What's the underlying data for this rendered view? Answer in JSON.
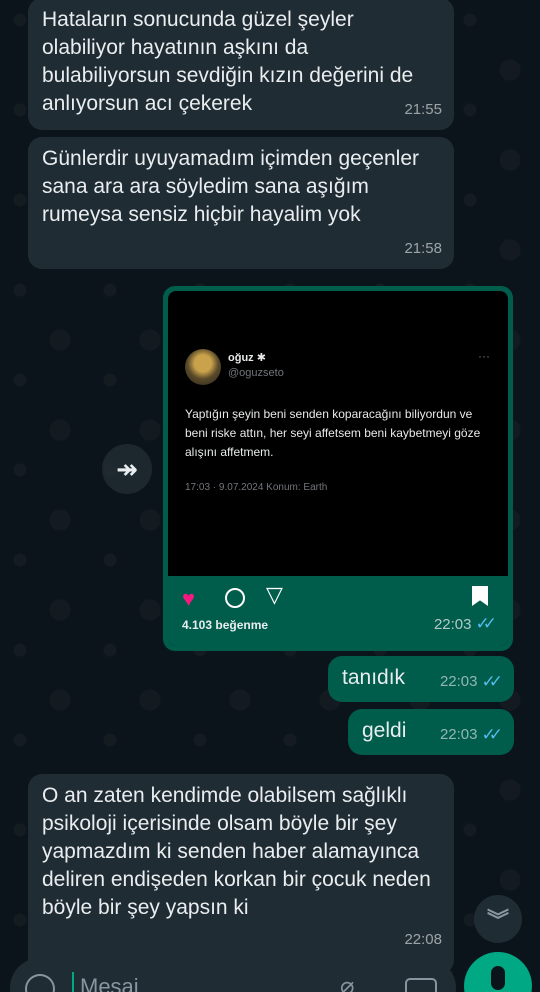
{
  "messages": [
    {
      "text": "Hataların sonucunda güzel şeyler olabiliyor hayatının aşkını da bulabiliyorsun sevdiğin kızın değerini de anlıyorsun acı çekerek",
      "time": "21:55"
    },
    {
      "text": "Günlerdir uyuyamadım içimden geçenler sana ara ara söyledim sana aşığım rumeysa sensiz hiçbir hayalim yok",
      "time": "21:58"
    },
    {
      "text": "tanıdık",
      "time": "22:03"
    },
    {
      "text": "geldi",
      "time": "22:03"
    },
    {
      "text": "O an zaten kendimde olabilsem sağlıklı psikoloji içerisinde olsam böyle bir şey yapmazdım ki senden haber alamayınca deliren endişeden korkan bir çocuk neden böyle bir şey yapsın ki",
      "time": "22:08"
    }
  ],
  "image_message": {
    "time": "22:03",
    "likes": "4.103 beğenme",
    "tweet": {
      "name": "oğuz ✱",
      "handle": "@oguzseto",
      "text": "Yaptığın şeyin beni senden koparacağını biliyordun ve beni riske attın, her seyi affetsem beni kaybetmeyi göze alışını affetmem.",
      "meta": "17:03 · 9.07.2024 Konum: Earth",
      "more": "···"
    }
  },
  "read_ticks": "✓✓",
  "input": {
    "placeholder": "Mesaj"
  },
  "colors": {
    "incoming": "#202c33",
    "outgoing": "#005c4b",
    "accent": "#00a884",
    "read_ticks": "#53bdeb"
  }
}
